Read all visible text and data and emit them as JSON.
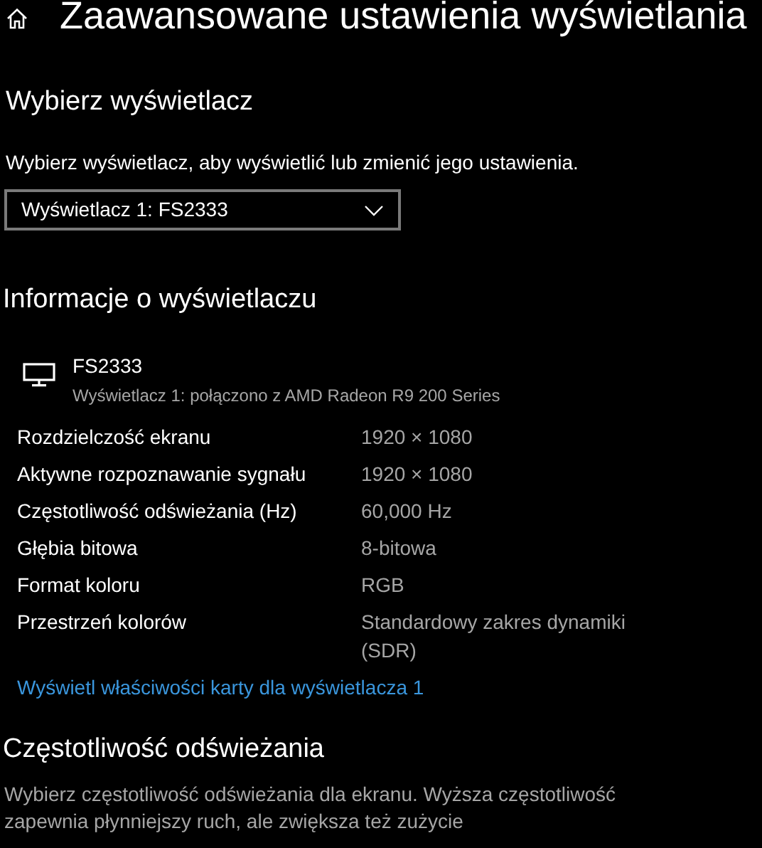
{
  "header": {
    "title": "Zaawansowane ustawienia wyświetlania"
  },
  "select_display": {
    "heading": "Wybierz wyświetlacz",
    "description": "Wybierz wyświetlacz, aby wyświetlić lub zmienić jego ustawienia.",
    "dropdown": {
      "value": "Wyświetlacz 1: FS2333"
    }
  },
  "display_info": {
    "heading": "Informacje o wyświetlaczu",
    "monitor": {
      "name": "FS2333",
      "subtitle": "Wyświetlacz 1: połączono z AMD Radeon R9 200 Series"
    },
    "rows": [
      {
        "label": "Rozdzielczość ekranu",
        "value": "1920 × 1080"
      },
      {
        "label": "Aktywne rozpoznawanie sygnału",
        "value": "1920 × 1080"
      },
      {
        "label": "Częstotliwość odświeżania (Hz)",
        "value": "60,000 Hz"
      },
      {
        "label": "Głębia bitowa",
        "value": "8-bitowa"
      },
      {
        "label": "Format koloru",
        "value": "RGB"
      },
      {
        "label": "Przestrzeń kolorów",
        "value": "Standardowy zakres dynamiki (SDR)"
      }
    ],
    "link": "Wyświetl właściwości karty dla wyświetlacza 1"
  },
  "refresh_rate": {
    "heading": "Częstotliwość odświeżania",
    "description": "Wybierz częstotliwość odświeżania dla ekranu. Wyższa częstotliwość zapewnia płynniejszy ruch, ale zwiększa też zużycie"
  }
}
